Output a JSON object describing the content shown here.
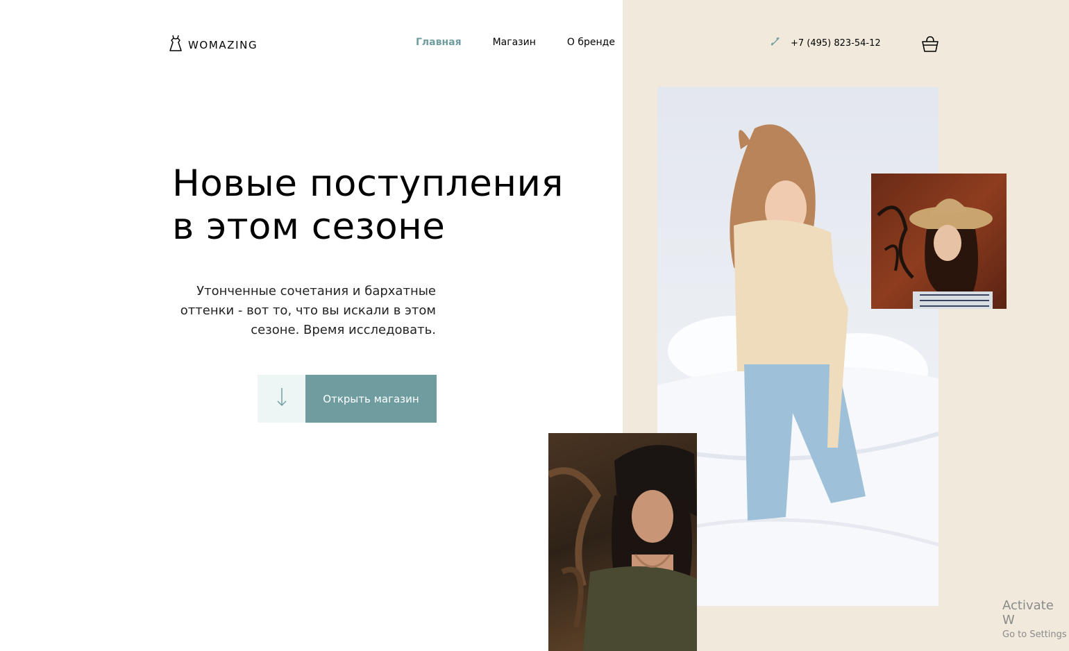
{
  "header": {
    "logo_text": "WOMAZING",
    "nav": [
      {
        "label": "Главная",
        "active": true
      },
      {
        "label": "Магазин",
        "active": false
      },
      {
        "label": "О бренде",
        "active": false
      }
    ],
    "phone": "+7 (495) 823-54-12",
    "icons": {
      "logo": "dress-icon",
      "phone": "phone-icon",
      "cart": "shopping-basket-icon"
    }
  },
  "hero": {
    "title_line1": "Новые поступления",
    "title_line2": "в этом сезоне",
    "subtitle_line1": "Утонченные сочетания и бархатные",
    "subtitle_line2": "оттенки - вот то, что вы искали в этом",
    "subtitle_line3": "сезоне. Время исследовать.",
    "cta_label": "Открыть магазин",
    "cta_icon": "arrow-down-icon"
  },
  "colors": {
    "accent": "#6e9c9f",
    "accent_light": "#eef5f5",
    "beige": "#f1eadc"
  },
  "watermark": {
    "line1": "Activate W",
    "line2": "Go to Settings"
  }
}
